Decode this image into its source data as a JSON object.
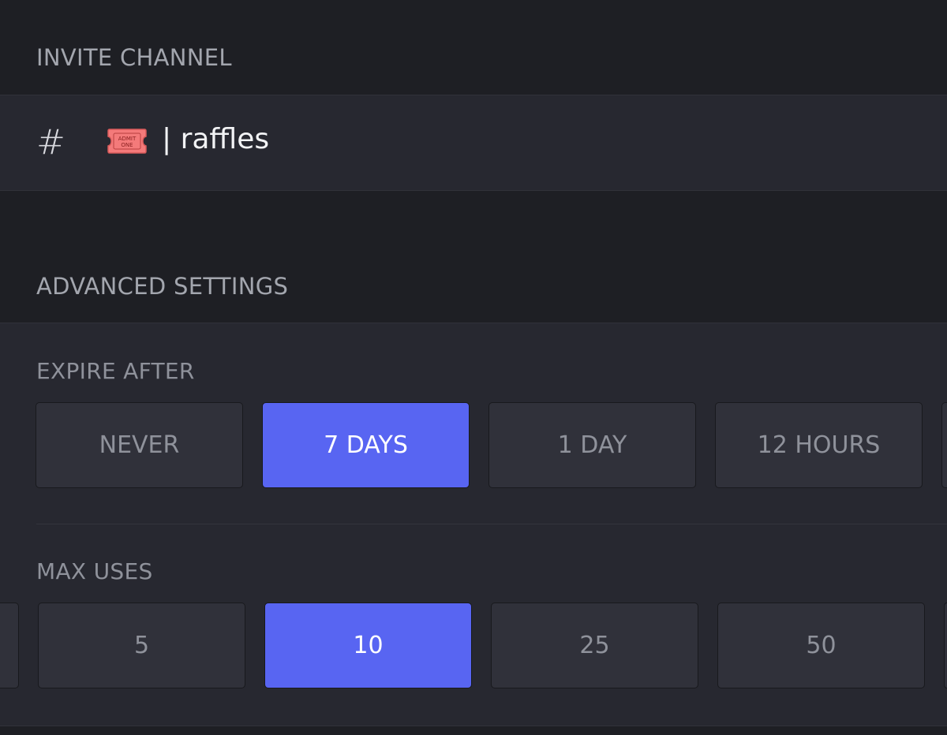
{
  "invite_channel": {
    "header": "INVITE CHANNEL",
    "channel_icon": "hash-icon",
    "emoji_icon": "admit-one-ticket-icon",
    "emoji_text_top": "ADMIT",
    "emoji_text_bottom": "ONE",
    "channel_name": "| raffles"
  },
  "advanced_settings": {
    "header": "ADVANCED SETTINGS",
    "expire_after": {
      "label": "EXPIRE AFTER",
      "selected": "7 DAYS",
      "options": [
        "NEVER",
        "7 DAYS",
        "1 DAY",
        "12 HOURS"
      ]
    },
    "max_uses": {
      "label": "MAX USES",
      "selected": "10",
      "options": [
        "5",
        "10",
        "25",
        "50"
      ]
    }
  },
  "colors": {
    "background": "#1e1f24",
    "panel": "#272830",
    "option": "#30313a",
    "accent": "#5865f2",
    "ticket": "#f47a7a"
  }
}
